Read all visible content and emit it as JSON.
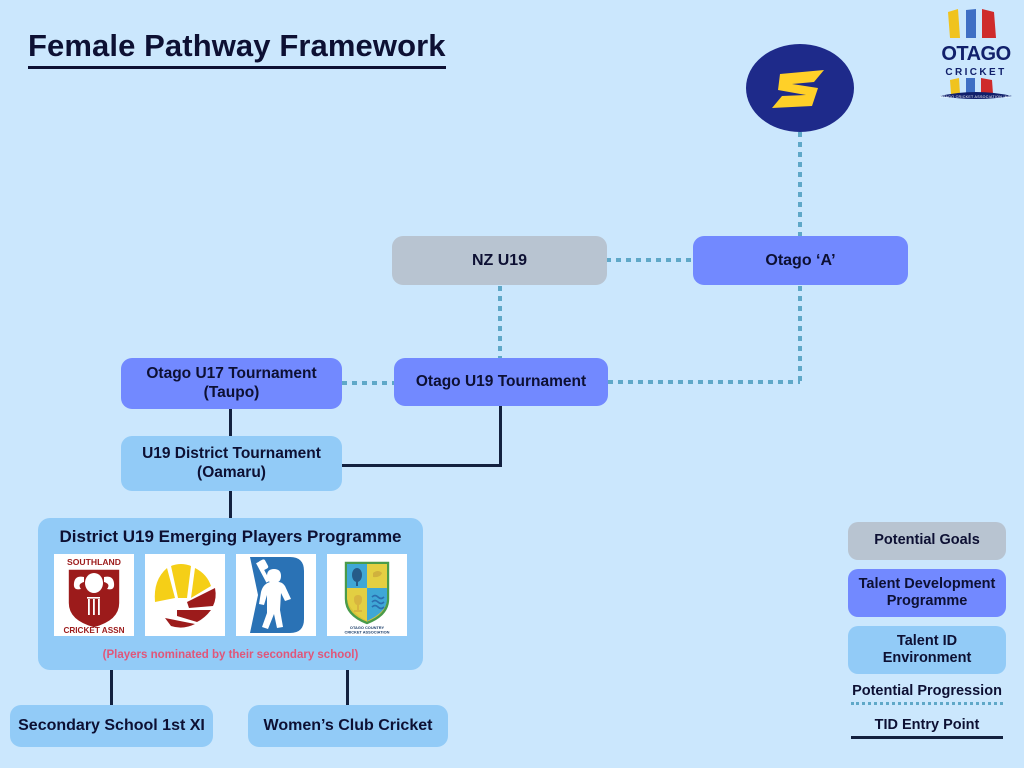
{
  "page": {
    "title": "Female Pathway Framework",
    "background_color": "#cbe7fd"
  },
  "brand": {
    "sparks_logo": "otago-sparks-s-logo",
    "otago_cricket": {
      "line1": "OTAGO",
      "line2": "C R I C K E T",
      "tagline": "OTAGO CRICKET ASSOCIATION INC."
    }
  },
  "nodes": {
    "nz_u19": "NZ U19",
    "otago_a": "Otago ‘A’",
    "otago_u17": "Otago U17 Tournament\n(Taupo)",
    "otago_u17_line1": "Otago U17 Tournament",
    "otago_u17_line2": "(Taupo)",
    "otago_u19": "Otago U19 Tournament",
    "u19_district_line1": "U19 District Tournament",
    "u19_district_line2": "(Oamaru)",
    "secondary_school": "Secondary School 1st XI",
    "womens_club": "Women’s Club Cricket"
  },
  "emerging": {
    "title": "District U19 Emerging Players Programme",
    "note": "(Players nominated by their secondary school)",
    "logos": [
      {
        "name": "southland-cricket-assn-logo",
        "top_text": "SOUTHLAND",
        "bottom_text": "CRICKET ASSN"
      },
      {
        "name": "north-otago-cricket-logo",
        "top_text": "",
        "bottom_text": ""
      },
      {
        "name": "dunedin-metro-cricket-logo",
        "top_text": "",
        "bottom_text": ""
      },
      {
        "name": "otago-country-cricket-association-logo",
        "top_text": "",
        "bottom_text": "OTAGO COUNTRY CRICKET ASSOCIATION"
      }
    ]
  },
  "legend": {
    "potential_goals": "Potential Goals",
    "talent_development": "Talent Development Programme",
    "talent_id": "Talent ID Environment",
    "potential_progression": "Potential Progression",
    "tid_entry_point": "TID Entry Point"
  },
  "colors": {
    "background": "#cbe7fd",
    "potential_goals": "#b8c4d1",
    "talent_development": "#7289ff",
    "talent_id": "#92cbf7",
    "progression_dotted": "#5fa8c8",
    "entry_solid": "#13213f",
    "note_text": "#e0567a",
    "text": "#0d1033"
  }
}
